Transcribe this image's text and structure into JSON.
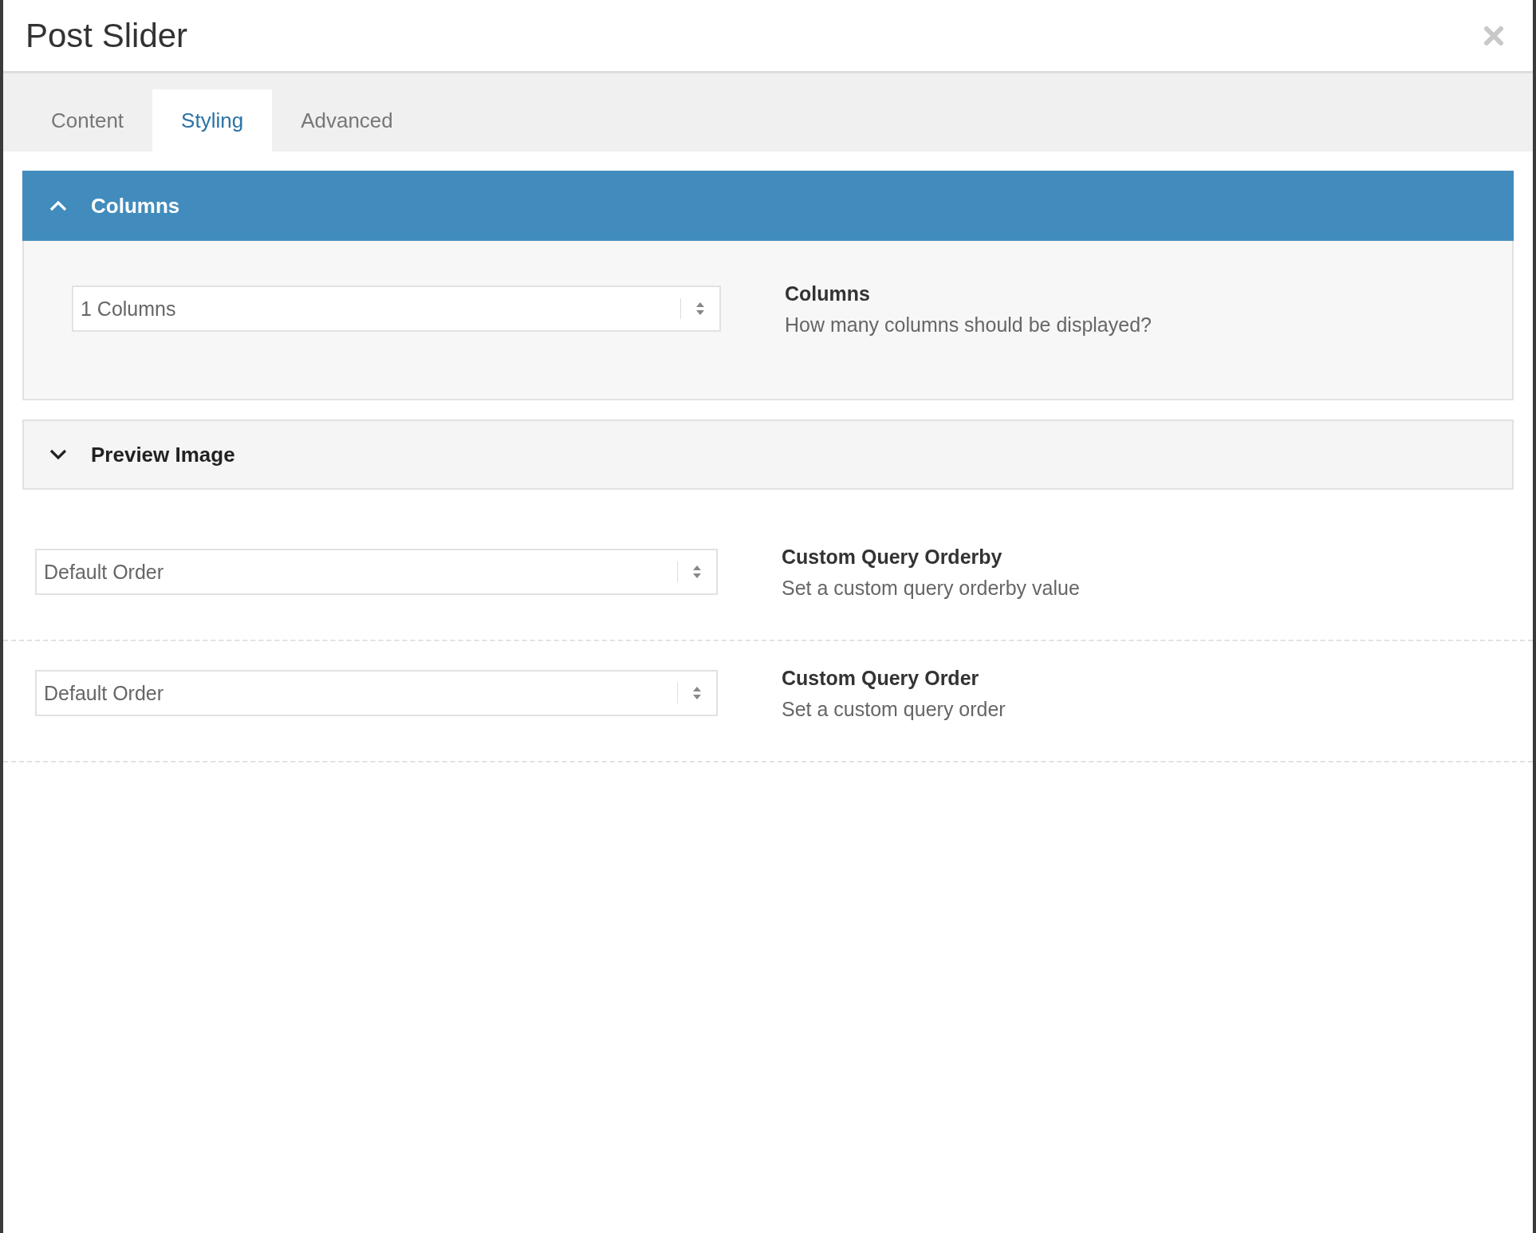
{
  "modal": {
    "title": "Post Slider"
  },
  "tabs": [
    {
      "label": "Content",
      "selected": false
    },
    {
      "label": "Styling",
      "selected": true
    },
    {
      "label": "Advanced",
      "selected": false
    }
  ],
  "panels": [
    {
      "title": "Columns",
      "expanded": true,
      "fields": [
        {
          "value": "1 Columns",
          "label": "Columns",
          "description": "How many columns should be displayed?"
        }
      ]
    },
    {
      "title": "Preview Image",
      "expanded": false
    }
  ],
  "fields": [
    {
      "value": "Default Order",
      "label": "Custom Query Orderby",
      "description": "Set a custom query orderby value"
    },
    {
      "value": "Default Order",
      "label": "Custom Query Order",
      "description": "Set a custom query order"
    }
  ]
}
